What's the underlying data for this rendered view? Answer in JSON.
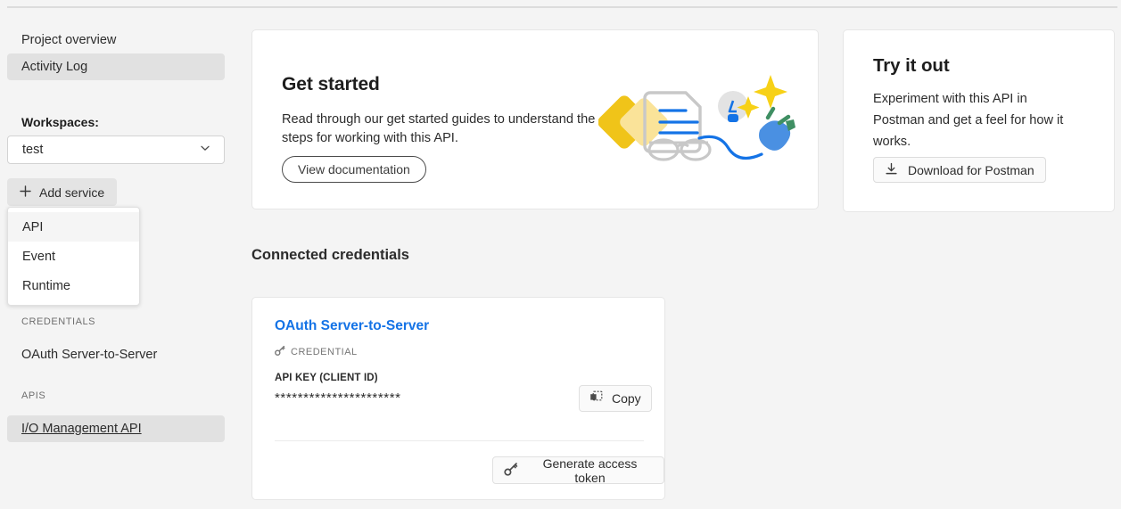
{
  "sidebar": {
    "nav": [
      {
        "label": "Project overview",
        "selected": false,
        "underlined": false
      },
      {
        "label": "Activity Log",
        "selected": true,
        "underlined": false
      }
    ],
    "workspaces_label": "Workspaces:",
    "workspace_value": "test",
    "add_service_label": "Add service",
    "dropdown": {
      "items": [
        {
          "label": "API",
          "hover": true
        },
        {
          "label": "Event",
          "hover": false
        },
        {
          "label": "Runtime",
          "hover": false
        }
      ]
    },
    "credentials_section_label": "CREDENTIALS",
    "credentials_items": [
      {
        "label": "OAuth Server-to-Server",
        "selected": false,
        "underlined": false
      }
    ],
    "apis_section_label": "APIS",
    "apis_items": [
      {
        "label": "I/O Management API",
        "selected": true,
        "underlined": true
      }
    ]
  },
  "get_started": {
    "title": "Get started",
    "body": "Read through our get started guides to understand the steps for working with this API.",
    "button_label": "View documentation"
  },
  "try_it_out": {
    "title": "Try it out",
    "body": "Experiment with this API in Postman and get a feel for how it works.",
    "button_label": "Download for Postman",
    "button_icon": "download-icon"
  },
  "connected_credentials": {
    "heading": "Connected credentials",
    "card": {
      "title": "OAuth Server-to-Server",
      "type_label": "CREDENTIAL",
      "type_icon": "key-icon",
      "api_key_label": "API KEY (CLIENT ID)",
      "api_key_value": "**********************",
      "copy_button_label": "Copy",
      "copy_button_icon": "copy-icon",
      "generate_token_label": "Generate access token",
      "generate_token_icon": "key-icon"
    }
  },
  "colors": {
    "page_background": "#f4f4f4",
    "card_background": "#ffffff",
    "link_blue": "#1473e6",
    "selected_item": "#e1e1e1",
    "accent_yellow": "#f0c419"
  }
}
